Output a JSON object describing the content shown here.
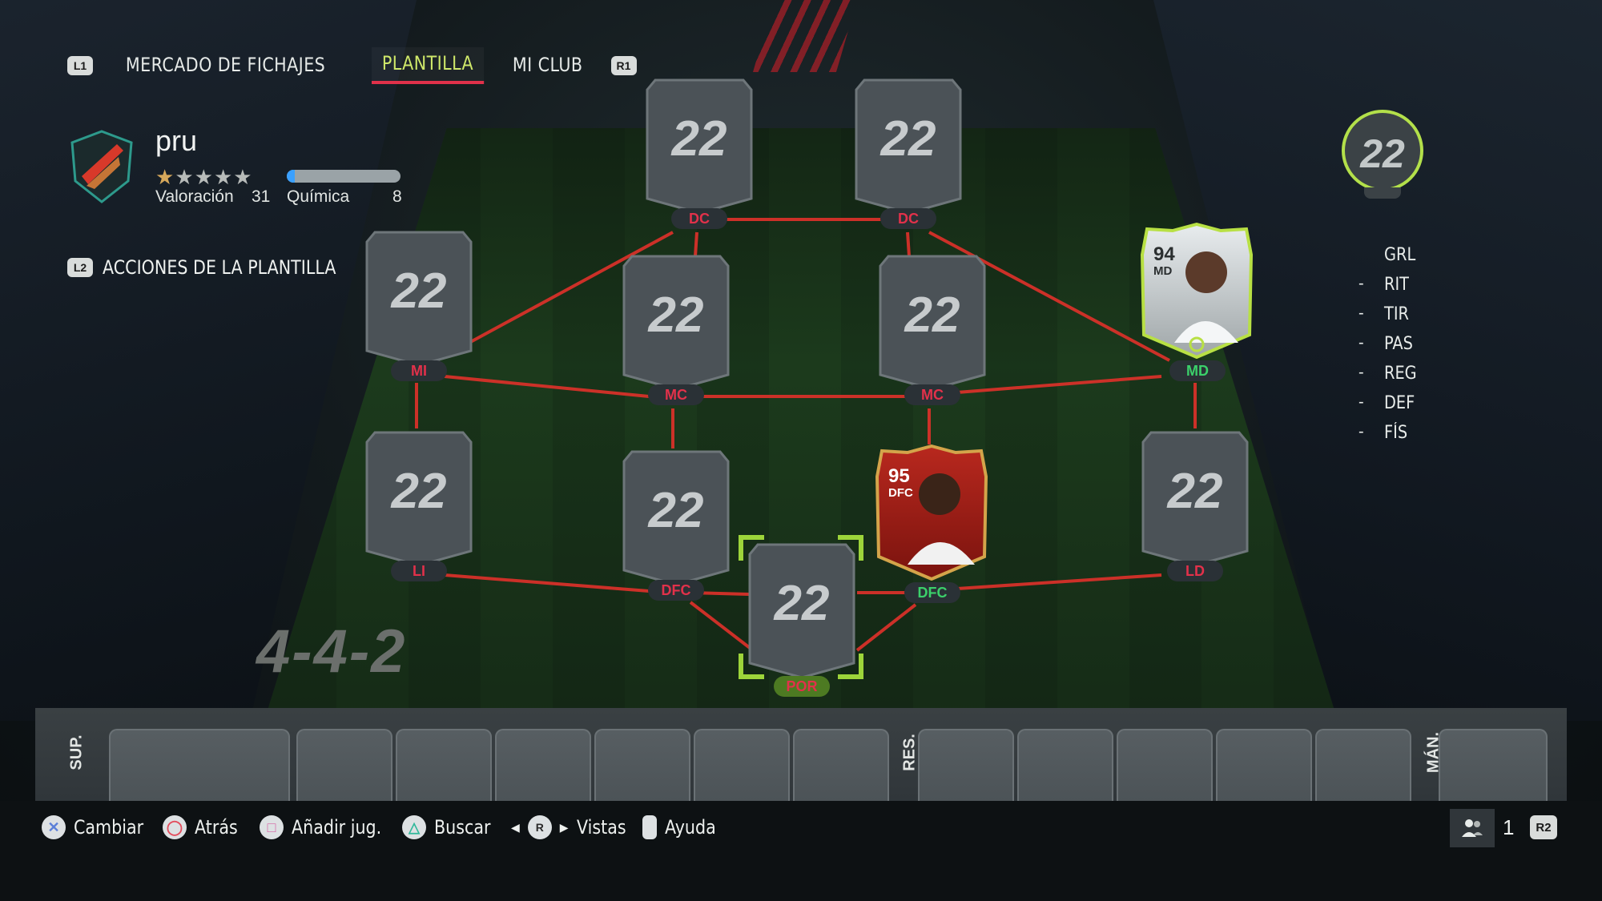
{
  "nav": {
    "left_badge": "L1",
    "tabs": [
      "MERCADO DE FICHAJES",
      "PLANTILLA",
      "MI CLUB"
    ],
    "active_tab": 1,
    "right_badge": "R1"
  },
  "squad": {
    "name": "pru",
    "stars_total": 5,
    "stars_filled": 1,
    "rating_label": "Valoración",
    "rating_value": "31",
    "chemistry_label": "Química",
    "chemistry_value": "8",
    "chemistry_fill": 0.07,
    "actions_badge": "L2",
    "actions_label": "ACCIONES DE LA PLANTILLA",
    "formation": "4-4-2"
  },
  "slots": [
    {
      "pos": "DC",
      "value": "22"
    },
    {
      "pos": "DC",
      "value": "22"
    },
    {
      "pos": "MI",
      "value": "22"
    },
    {
      "pos": "MC",
      "value": "22"
    },
    {
      "pos": "MC",
      "value": "22"
    },
    {
      "pos": "LI",
      "value": "22"
    },
    {
      "pos": "DFC",
      "value": "22"
    },
    {
      "pos": "POR",
      "value": "22"
    },
    {
      "pos": "LD",
      "value": "22"
    }
  ],
  "player_cards": [
    {
      "pos_label": "MD",
      "ovr": "94",
      "card_pos": "MD",
      "theme": "white-green"
    },
    {
      "pos_label": "DFC",
      "ovr": "95",
      "card_pos": "DFC",
      "theme": "red-gold"
    }
  ],
  "overall": {
    "value": "22",
    "label": "GRL"
  },
  "stats": [
    {
      "label": "RIT",
      "value": "-"
    },
    {
      "label": "TIR",
      "value": "-"
    },
    {
      "label": "PAS",
      "value": "-"
    },
    {
      "label": "REG",
      "value": "-"
    },
    {
      "label": "DEF",
      "value": "-"
    },
    {
      "label": "FÍS",
      "value": "-"
    }
  ],
  "bench": {
    "subs_label": "SUP.",
    "reserves_label": "RES.",
    "manager_label": "MÁN."
  },
  "hints": [
    {
      "icon": "cross-button-icon",
      "label": "Cambiar"
    },
    {
      "icon": "circle-button-icon",
      "label": "Atrás"
    },
    {
      "icon": "square-button-icon",
      "label": "Añadir jug."
    },
    {
      "icon": "triangle-button-icon",
      "label": "Buscar"
    },
    {
      "icon": "r-stick-icon",
      "glyph": "R",
      "label": "Vistas"
    },
    {
      "icon": "touchpad-icon",
      "label": "Ayuda"
    }
  ],
  "footer_right": {
    "icon": "users-icon",
    "count": "1",
    "badge": "R2"
  },
  "colors": {
    "accent": "#cfe86a",
    "link": "#e0314a",
    "selector": "#9dd43a",
    "chem": "#3aa0ff"
  }
}
